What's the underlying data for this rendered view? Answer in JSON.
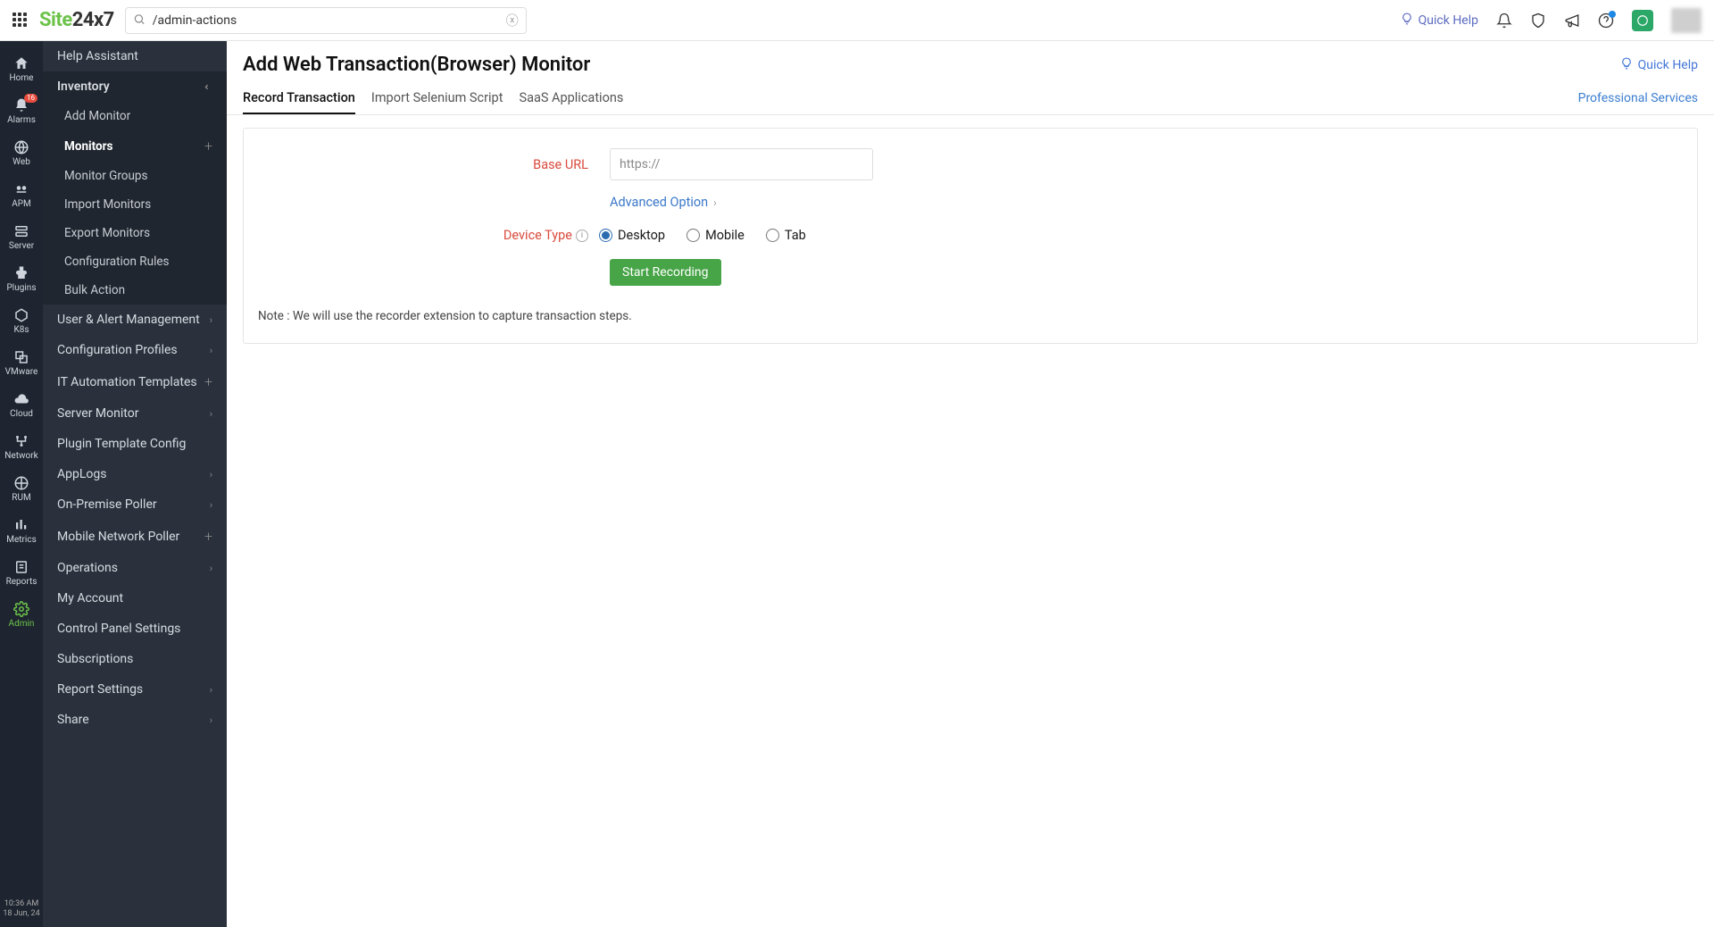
{
  "top": {
    "search_value": "/admin-actions",
    "quickhelp": "Quick Help"
  },
  "rail": {
    "items": [
      {
        "label": "Home"
      },
      {
        "label": "Alarms",
        "badge": "16"
      },
      {
        "label": "Web"
      },
      {
        "label": "APM"
      },
      {
        "label": "Server"
      },
      {
        "label": "Plugins"
      },
      {
        "label": "K8s"
      },
      {
        "label": "VMware"
      },
      {
        "label": "Cloud"
      },
      {
        "label": "Network"
      },
      {
        "label": "RUM"
      },
      {
        "label": "Metrics"
      },
      {
        "label": "Reports"
      },
      {
        "label": "Admin"
      }
    ],
    "time": "10:36 AM",
    "date": "18 Jun, 24"
  },
  "sidenav": {
    "top_item": "Help Assistant",
    "inventory_label": "Inventory",
    "inventory_sub": [
      {
        "label": "Add Monitor"
      },
      {
        "label": "Monitors",
        "active": true,
        "plus": true
      },
      {
        "label": "Monitor Groups"
      },
      {
        "label": "Import Monitors"
      },
      {
        "label": "Export Monitors"
      },
      {
        "label": "Configuration Rules"
      },
      {
        "label": "Bulk Action"
      }
    ],
    "rest": [
      {
        "label": "User & Alert Management",
        "chev": true
      },
      {
        "label": "Configuration Profiles",
        "chev": true
      },
      {
        "label": "IT Automation Templates",
        "plus": true
      },
      {
        "label": "Server Monitor",
        "chev": true
      },
      {
        "label": "Plugin Template Config"
      },
      {
        "label": "AppLogs",
        "chev": true
      },
      {
        "label": "On-Premise Poller",
        "chev": true
      },
      {
        "label": "Mobile Network Poller",
        "plus": true
      },
      {
        "label": "Operations",
        "chev": true
      },
      {
        "label": "My Account"
      },
      {
        "label": "Control Panel Settings"
      },
      {
        "label": "Subscriptions"
      },
      {
        "label": "Report Settings",
        "chev": true
      },
      {
        "label": "Share",
        "chev": true
      }
    ]
  },
  "page": {
    "title": "Add Web Transaction(Browser) Monitor",
    "quickhelp": "Quick Help",
    "tabs": [
      "Record Transaction",
      "Import Selenium Script",
      "SaaS Applications"
    ],
    "tabs_right": "Professional Services",
    "form": {
      "base_url_label": "Base URL",
      "base_url_placeholder": "https://",
      "advanced_link": "Advanced Option",
      "device_type_label": "Device Type",
      "device_options": [
        "Desktop",
        "Mobile",
        "Tab"
      ],
      "button": "Start Recording",
      "note": "Note : We will use the recorder extension to capture transaction steps."
    }
  }
}
